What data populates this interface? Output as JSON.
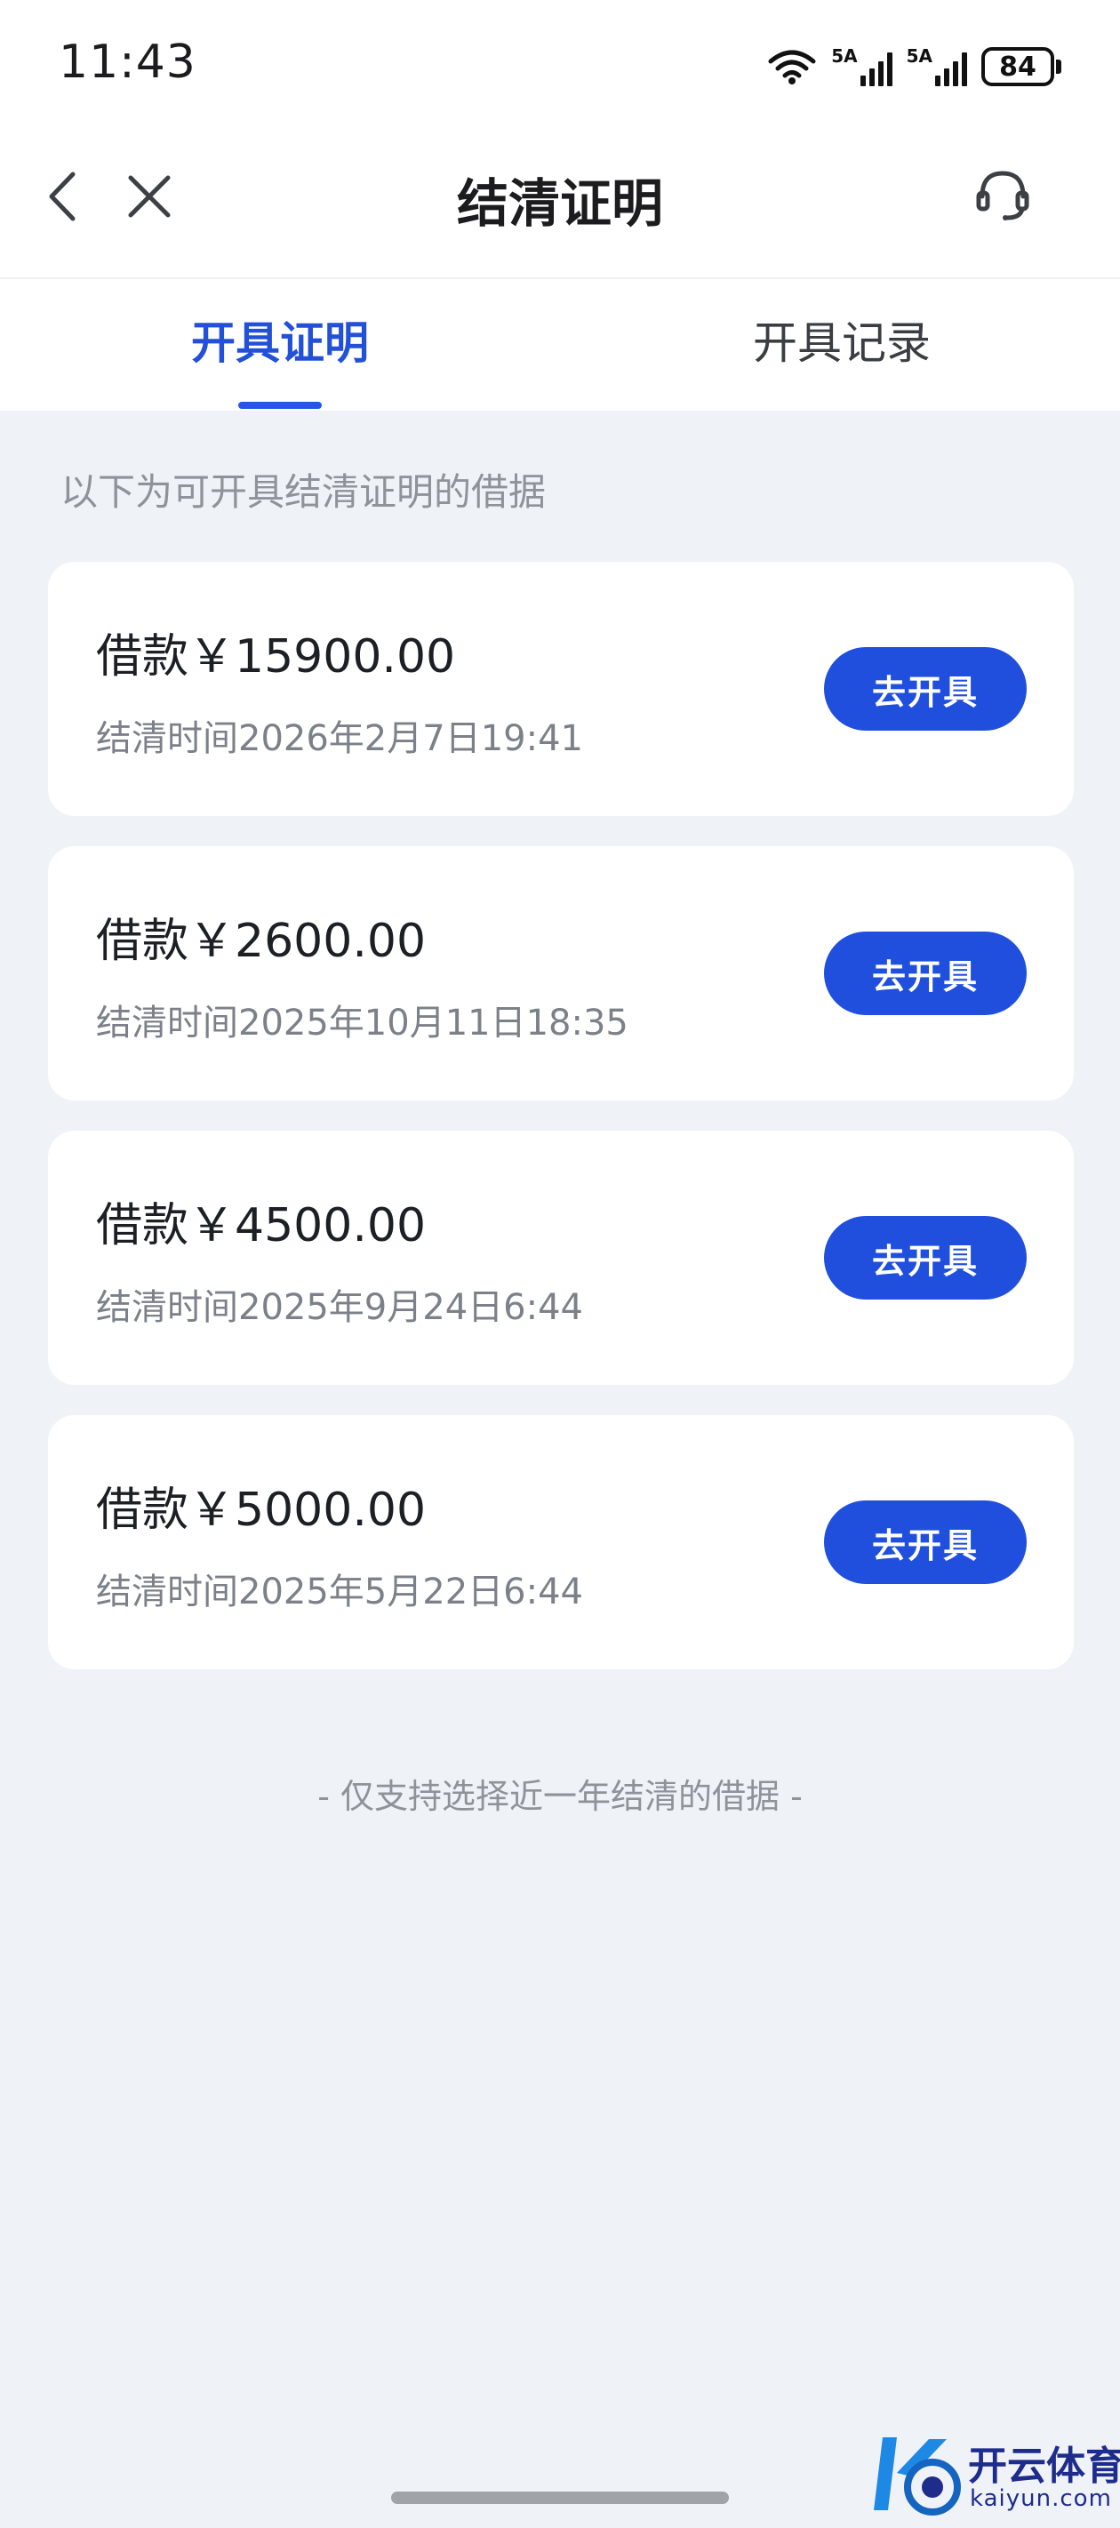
{
  "status_bar": {
    "time": "11:43",
    "network_1": "5A",
    "network_2": "5A",
    "battery": "84",
    "icons": [
      "wifi-icon",
      "signal-icon",
      "battery-icon"
    ]
  },
  "nav": {
    "title": "结清证明",
    "icons": [
      "back-icon",
      "close-icon",
      "headset-icon"
    ]
  },
  "tabs": [
    {
      "label": "开具证明",
      "active": true
    },
    {
      "label": "开具记录",
      "active": false
    }
  ],
  "hint": "以下为可开具结清证明的借据",
  "loans": [
    {
      "amount": "借款￥15900.00",
      "settled_time": "结清时间2026年2月7日19:41",
      "button": "去开具"
    },
    {
      "amount": "借款￥2600.00",
      "settled_time": "结清时间2025年10月11日18:35",
      "button": "去开具"
    },
    {
      "amount": "借款￥4500.00",
      "settled_time": "结清时间2025年9月24日6:44",
      "button": "去开具"
    },
    {
      "amount": "借款￥5000.00",
      "settled_time": "结清时间2025年5月22日6:44",
      "button": "去开具"
    }
  ],
  "footer_note": "- 仅支持选择近一年结清的借据 -",
  "watermark": {
    "name": "开云体育",
    "domain": "kaiyun.com"
  },
  "colors": {
    "accent": "#1f4fdc",
    "background": "#eff2f7",
    "card": "#ffffff",
    "muted_text": "#8e939a"
  }
}
